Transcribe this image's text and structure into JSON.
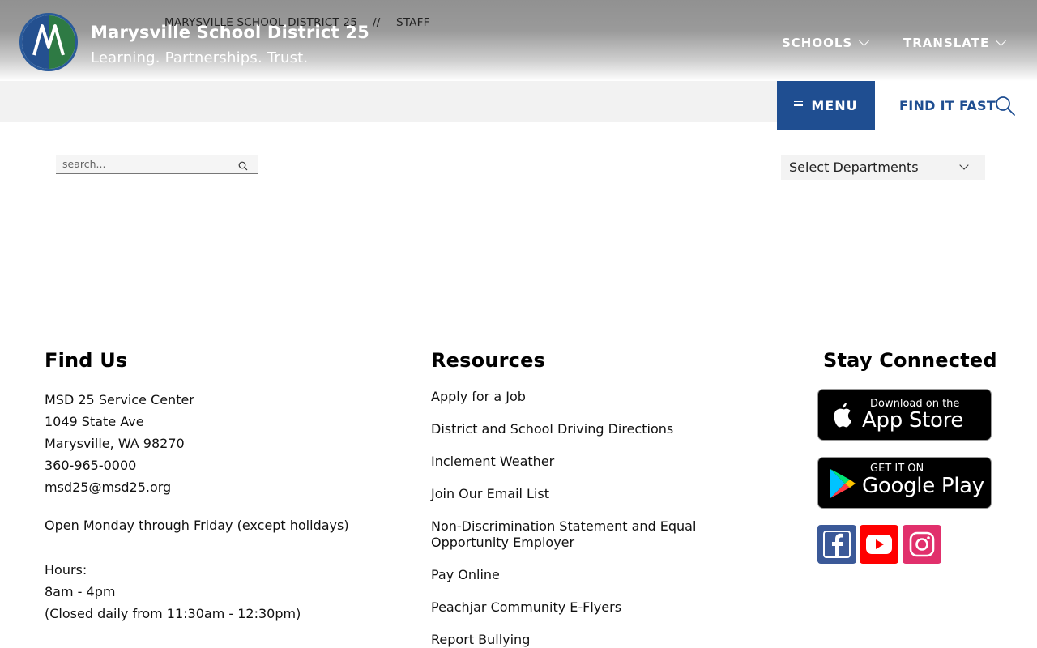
{
  "header": {
    "site_name": "Marysville School District 25",
    "tagline": "Learning. Partnerships. Trust.",
    "nav": {
      "schools": "SCHOOLS",
      "translate": "TRANSLATE"
    }
  },
  "breadcrumb": {
    "home": "MARYSVILLE SCHOOL DISTRICT 25",
    "separator": "//",
    "current": "STAFF"
  },
  "menu": {
    "label": "MENU"
  },
  "find_it_fast": {
    "label": "FIND IT FAST"
  },
  "search": {
    "placeholder": "search..."
  },
  "departments": {
    "selected": "Select Departments"
  },
  "footer": {
    "find_us": {
      "title": "Find Us",
      "name": "MSD 25 Service Center",
      "street": "1049 State Ave",
      "city": "Marysville, WA 98270",
      "phone": "360-965-0000",
      "email": "msd25@msd25.org",
      "open": "Open Monday through Friday (except holidays)",
      "hours_label": "Hours:",
      "hours": "8am - 4pm",
      "closed": "(Closed daily from 11:30am - 12:30pm)"
    },
    "resources": {
      "title": "Resources",
      "links": [
        "Apply for a Job",
        "District and School Driving Directions",
        "Inclement Weather",
        "Join Our Email List",
        "Non-Discrimination Statement and Equal Opportunity Employer",
        "Pay Online",
        "Peachjar Community E-Flyers",
        "Report Bullying"
      ]
    },
    "stay_connected": {
      "title": "Stay Connected",
      "app_store": {
        "small": "Download on the",
        "big": "App Store"
      },
      "google_play": {
        "small": "GET IT ON",
        "big": "Google Play"
      },
      "social_icons": [
        "facebook-icon",
        "youtube-icon",
        "instagram-icon"
      ]
    }
  },
  "colors": {
    "brand_blue": "#1f4e91",
    "logo_green": "#2e7a44",
    "facebook": "#3b5998",
    "youtube": "#ff0000",
    "instagram": "#e1306c"
  }
}
